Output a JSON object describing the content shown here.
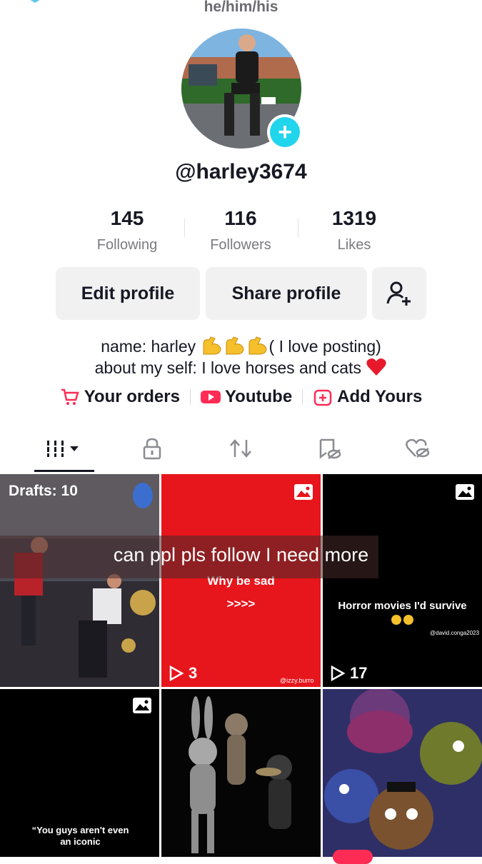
{
  "header": {
    "pronouns": "he/him/his"
  },
  "profile": {
    "username": "@harley3674",
    "avatar_alt": "profile photo",
    "stats": [
      {
        "value": "145",
        "label": "Following"
      },
      {
        "value": "116",
        "label": "Followers"
      },
      {
        "value": "1319",
        "label": "Likes"
      }
    ],
    "buttons": {
      "edit": "Edit profile",
      "share": "Share profile"
    },
    "bio": {
      "line1_a": "name: harley ",
      "line1_b": "( I love posting)",
      "line2": "about my self: I love horses and cats "
    },
    "links": [
      {
        "icon": "cart-icon",
        "label": "Your orders"
      },
      {
        "icon": "youtube-icon",
        "label": "Youtube"
      },
      {
        "icon": "add-yours-icon",
        "label": "Add Yours"
      }
    ]
  },
  "tabs": [
    {
      "name": "videos",
      "icon": "grid-icon"
    },
    {
      "name": "private",
      "icon": "lock-icon"
    },
    {
      "name": "reposts",
      "icon": "repost-icon"
    },
    {
      "name": "favorites",
      "icon": "bookmark-hidden-icon"
    },
    {
      "name": "liked",
      "icon": "heart-hidden-icon"
    }
  ],
  "grid": {
    "drafts_label": "Drafts: 10",
    "caption_overlay": "can ppl pls follow I need more",
    "post2": {
      "text1": "Why be sad",
      "text2": ">>>>",
      "plays": "3",
      "watermark": "@izzy.burro"
    },
    "post3": {
      "text": "Horror movies I'd survive",
      "plays": "17",
      "watermark": "@david.conga2023"
    },
    "post4": {
      "text": "“You guys aren't even an iconic"
    }
  },
  "colors": {
    "accent_cyan": "#20d5ec",
    "brand_red": "#fe2c55",
    "text": "#161823",
    "secondary_text": "#7a7a80",
    "button_bg": "#f1f1f2"
  }
}
